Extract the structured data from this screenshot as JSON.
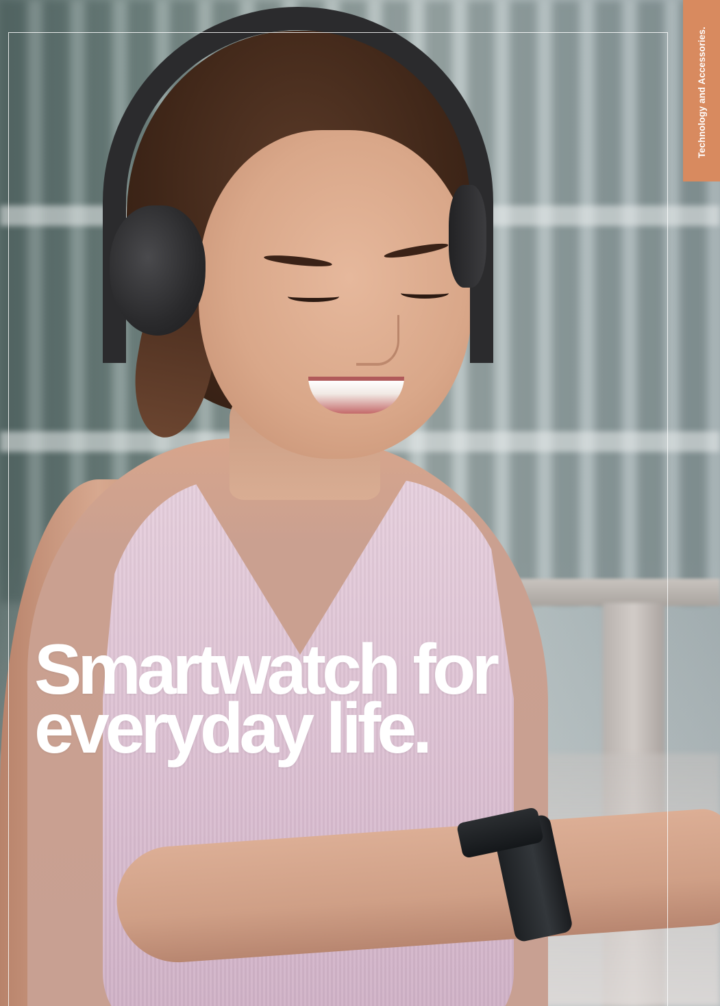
{
  "side_tab": {
    "label": "Technology and Accessories."
  },
  "headline": {
    "line1": "Smartwatch for",
    "line2": "everyday life."
  },
  "colors": {
    "accent_tab": "#d88a5f",
    "headline_text": "#ffffff",
    "frame_line": "#ffffff"
  }
}
